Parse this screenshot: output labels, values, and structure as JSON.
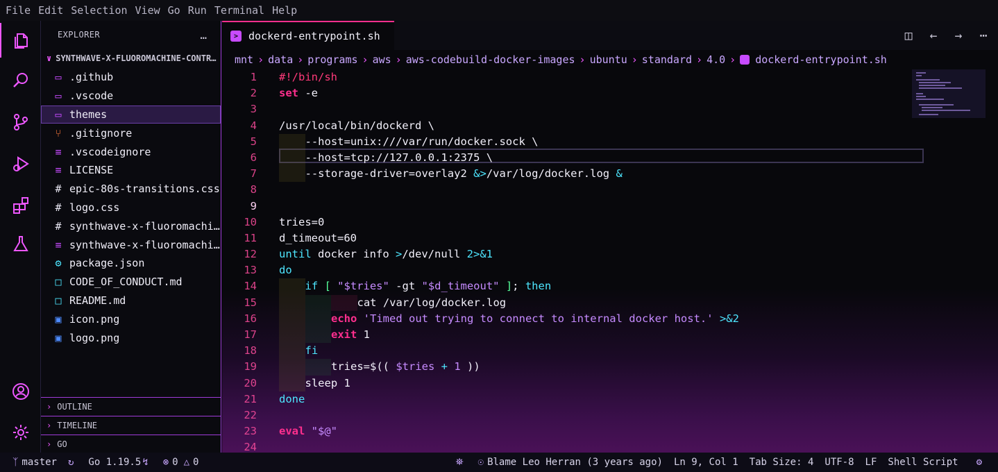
{
  "menubar": [
    "File",
    "Edit",
    "Selection",
    "View",
    "Go",
    "Run",
    "Terminal",
    "Help"
  ],
  "activity": [
    "files-icon",
    "search-icon",
    "source-control-icon",
    "run-debug-icon",
    "extensions-icon",
    "flask-icon",
    "account-icon",
    "gear-icon"
  ],
  "sidebar": {
    "title": "EXPLORER",
    "more": "…",
    "project": "SYNTHWAVE-X-FLUOROMACHINE-CONTR…",
    "files": [
      {
        "name": ".github",
        "icon": "folder-icon",
        "selected": false
      },
      {
        "name": ".vscode",
        "icon": "folder-icon",
        "selected": false
      },
      {
        "name": "themes",
        "icon": "folder-icon",
        "selected": true
      },
      {
        "name": ".gitignore",
        "icon": "git-icon",
        "selected": false
      },
      {
        "name": ".vscodeignore",
        "icon": "lines-icon",
        "selected": false
      },
      {
        "name": "LICENSE",
        "icon": "lines-icon",
        "selected": false
      },
      {
        "name": "epic-80s-transitions.css",
        "icon": "hash-icon",
        "selected": false
      },
      {
        "name": "logo.css",
        "icon": "hash-icon",
        "selected": false
      },
      {
        "name": "synthwave-x-fluoromachine.css",
        "icon": "hash-icon",
        "selected": false
      },
      {
        "name": "synthwave-x-fluoromachine.json",
        "icon": "lines-icon",
        "selected": false
      },
      {
        "name": "package.json",
        "icon": "gear-icon",
        "selected": false
      },
      {
        "name": "CODE_OF_CONDUCT.md",
        "icon": "book-icon",
        "selected": false
      },
      {
        "name": "README.md",
        "icon": "book-icon",
        "selected": false
      },
      {
        "name": "icon.png",
        "icon": "image-icon",
        "selected": false
      },
      {
        "name": "logo.png",
        "icon": "image-icon",
        "selected": false
      }
    ],
    "panels": [
      "OUTLINE",
      "TIMELINE",
      "GO"
    ]
  },
  "editor": {
    "tab": "dockerd-entrypoint.sh",
    "breadcrumbs": [
      "mnt",
      "data",
      "programs",
      "aws",
      "aws-codebuild-docker-images",
      "ubuntu",
      "standard",
      "4.0",
      "dockerd-entrypoint.sh"
    ],
    "current_line": 9,
    "lines": [
      {
        "n": "1",
        "seg": [
          {
            "t": "#!/bin/sh",
            "c": "sb"
          }
        ]
      },
      {
        "n": "2",
        "seg": [
          {
            "t": "set",
            "c": "kw"
          },
          {
            "t": " -e",
            "c": ""
          }
        ]
      },
      {
        "n": "3",
        "seg": []
      },
      {
        "n": "4",
        "seg": [
          {
            "t": "/usr/local/bin/dockerd \\",
            "c": ""
          }
        ]
      },
      {
        "n": "5",
        "ind": [
          1
        ],
        "seg": [
          {
            "t": "--host=unix:///var/run/docker.sock \\",
            "c": ""
          }
        ]
      },
      {
        "n": "6",
        "ind": [
          1
        ],
        "seg": [
          {
            "t": "--host=tcp://127.0.0.1:2375 \\",
            "c": ""
          }
        ]
      },
      {
        "n": "7",
        "ind": [
          1
        ],
        "seg": [
          {
            "t": "--storage-driver=overlay2 ",
            "c": ""
          },
          {
            "t": "&>",
            "c": "op"
          },
          {
            "t": "/var/log/docker.log ",
            "c": ""
          },
          {
            "t": "&",
            "c": "op"
          }
        ]
      },
      {
        "n": "8",
        "seg": []
      },
      {
        "n": "9",
        "seg": []
      },
      {
        "n": "10",
        "seg": [
          {
            "t": "tries=0",
            "c": ""
          }
        ]
      },
      {
        "n": "11",
        "seg": [
          {
            "t": "d_timeout=60",
            "c": ""
          }
        ]
      },
      {
        "n": "12",
        "seg": [
          {
            "t": "until",
            "c": "cy"
          },
          {
            "t": " docker info ",
            "c": ""
          },
          {
            "t": ">",
            "c": "op"
          },
          {
            "t": "/dev/null ",
            "c": ""
          },
          {
            "t": "2>&1",
            "c": "op"
          }
        ]
      },
      {
        "n": "13",
        "seg": [
          {
            "t": "do",
            "c": "cy"
          }
        ]
      },
      {
        "n": "14",
        "ind": [
          1
        ],
        "seg": [
          {
            "t": "if",
            "c": "cy"
          },
          {
            "t": " [ ",
            "c": "gn"
          },
          {
            "t": "\"$tries\"",
            "c": "str"
          },
          {
            "t": " -gt ",
            "c": ""
          },
          {
            "t": "\"$d_timeout\"",
            "c": "str"
          },
          {
            "t": " ]",
            "c": "gn"
          },
          {
            "t": "; ",
            "c": ""
          },
          {
            "t": "then",
            "c": "cy"
          }
        ]
      },
      {
        "n": "15",
        "ind": [
          1,
          2,
          3
        ],
        "seg": [
          {
            "t": "cat /var/log/docker.log",
            "c": ""
          }
        ]
      },
      {
        "n": "16",
        "ind": [
          1,
          2
        ],
        "seg": [
          {
            "t": "echo",
            "c": "kw"
          },
          {
            "t": " ",
            "c": ""
          },
          {
            "t": "'Timed out trying to connect to internal docker host.'",
            "c": "str"
          },
          {
            "t": " ",
            "c": ""
          },
          {
            "t": ">&2",
            "c": "op"
          }
        ]
      },
      {
        "n": "17",
        "ind": [
          1,
          2
        ],
        "seg": [
          {
            "t": "exit",
            "c": "kw"
          },
          {
            "t": " 1",
            "c": ""
          }
        ]
      },
      {
        "n": "18",
        "ind": [
          1
        ],
        "seg": [
          {
            "t": "fi",
            "c": "cy"
          }
        ]
      },
      {
        "n": "19",
        "ind": [
          1,
          2
        ],
        "seg": [
          {
            "t": "tries=$(( ",
            "c": ""
          },
          {
            "t": "$tries",
            "c": "var"
          },
          {
            "t": " + ",
            "c": "op"
          },
          {
            "t": "1",
            "c": "num"
          },
          {
            "t": " ))",
            "c": ""
          }
        ]
      },
      {
        "n": "20",
        "ind": [
          1
        ],
        "seg": [
          {
            "t": "sleep 1",
            "c": ""
          }
        ]
      },
      {
        "n": "21",
        "seg": [
          {
            "t": "done",
            "c": "cy"
          }
        ]
      },
      {
        "n": "22",
        "seg": []
      },
      {
        "n": "23",
        "seg": [
          {
            "t": "eval",
            "c": "kw"
          },
          {
            "t": " ",
            "c": ""
          },
          {
            "t": "\"$@\"",
            "c": "str"
          }
        ]
      },
      {
        "n": "24",
        "seg": []
      }
    ]
  },
  "status": {
    "branch": "master",
    "go_version": "Go 1.19.5",
    "errors": "0",
    "warnings": "0",
    "blame": "Blame Leo Herran (3 years ago)",
    "position": "Ln 9, Col 1",
    "tab_size": "Tab Size: 4",
    "encoding": "UTF-8",
    "eol": "LF",
    "language": "Shell Script"
  }
}
